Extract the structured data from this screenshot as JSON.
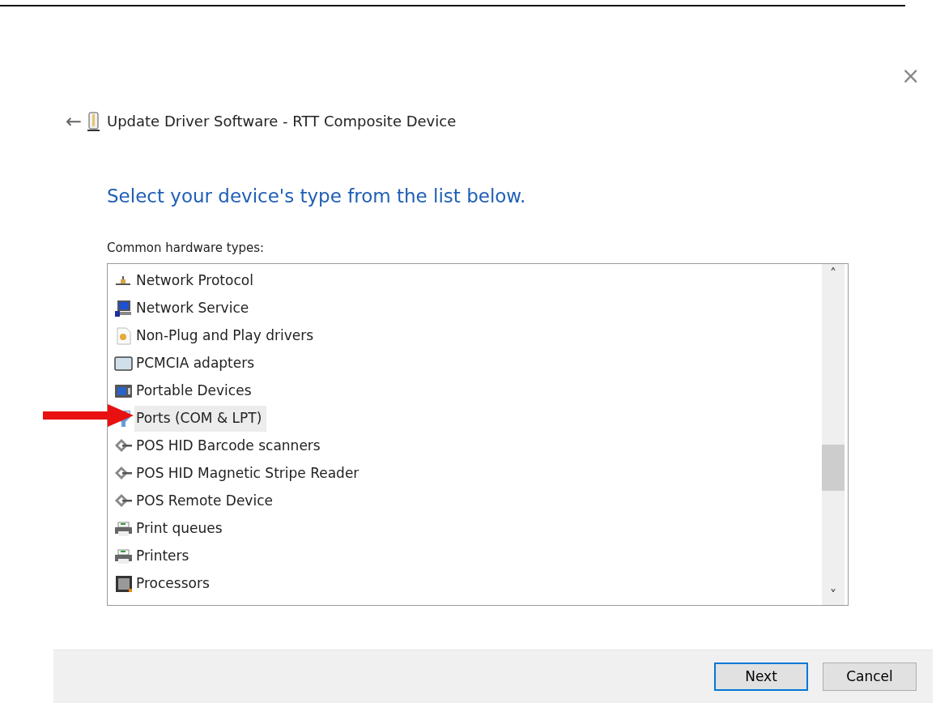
{
  "window": {
    "close": "×",
    "back": "←"
  },
  "title": "Update Driver Software - RTT Composite Device",
  "heading": "Select your device's type from the list below.",
  "list_label": "Common hardware types:",
  "items": [
    {
      "label": "Network Protocol",
      "kind": "protocol",
      "selected": false
    },
    {
      "label": "Network Service",
      "kind": "service",
      "selected": false
    },
    {
      "label": "Non-Plug and Play drivers",
      "kind": "driver",
      "selected": false
    },
    {
      "label": "PCMCIA adapters",
      "kind": "pcmcia",
      "selected": false
    },
    {
      "label": "Portable Devices",
      "kind": "portable",
      "selected": false
    },
    {
      "label": "Ports (COM & LPT)",
      "kind": "port",
      "selected": true
    },
    {
      "label": "POS HID Barcode scanners",
      "kind": "pos",
      "selected": false
    },
    {
      "label": "POS HID Magnetic Stripe Reader",
      "kind": "pos",
      "selected": false
    },
    {
      "label": "POS Remote Device",
      "kind": "pos",
      "selected": false
    },
    {
      "label": "Print queues",
      "kind": "printer",
      "selected": false
    },
    {
      "label": "Printers",
      "kind": "printer",
      "selected": false
    },
    {
      "label": "Processors",
      "kind": "processor",
      "selected": false
    }
  ],
  "scrollbar": {
    "up": "˄",
    "down": "˅"
  },
  "buttons": [
    {
      "label": "Next",
      "default": true
    },
    {
      "label": "Cancel",
      "default": false
    }
  ]
}
